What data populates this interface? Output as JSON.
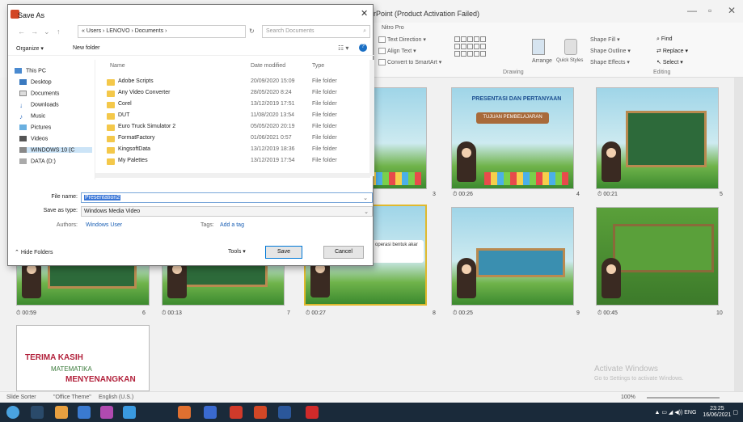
{
  "ppt": {
    "title": "rPoint (Product Activation Failed)",
    "tab_label": "Nitro Pro",
    "ribbon": {
      "text_direction": "Text Direction",
      "align_text": "Align Text",
      "convert_smartart": "Convert to SmartArt",
      "arrange": "Arrange",
      "quick_styles": "Quick Styles",
      "shape_fill": "Shape Fill",
      "shape_outline": "Shape Outline",
      "shape_effects": "Shape Effects",
      "find": "Find",
      "replace": "Replace",
      "select": "Select",
      "group_drawing": "Drawing",
      "group_editing": "Editing"
    }
  },
  "slides": [
    {
      "num": "3",
      "time": ""
    },
    {
      "num": "4",
      "time": "00:26",
      "title": "PRESENTASI DAN PERTANYAAN",
      "box": "TUJUAN PEMBELAJARAN"
    },
    {
      "num": "5",
      "time": "00:21"
    },
    {
      "num": "6",
      "time": "00:59"
    },
    {
      "num": "7",
      "time": "00:13"
    },
    {
      "num": "8",
      "time": "00:27",
      "box": "Hitunglah operasi bentuk akar"
    },
    {
      "num": "9",
      "time": "00:25"
    },
    {
      "num": "10",
      "time": "00:45"
    }
  ],
  "end_slide": {
    "line1": "TERIMA KASIH",
    "line2": "MATEMATIKA",
    "line3": "MENYENANGKAN"
  },
  "watermark": {
    "line1": "Activate Windows",
    "line2": "Go to Settings to activate Windows."
  },
  "status": {
    "view": "Slide Sorter",
    "theme": "\"Office Theme\"",
    "lang": "English (U.S.)",
    "zoom": "100%"
  },
  "tray": {
    "lang": "ENG",
    "time": "23:25",
    "date": "16/06/2021"
  },
  "dialog": {
    "title": "Save As",
    "address": "« Users › LENOVO › Documents ›",
    "search_placeholder": "Search Documents",
    "organize": "Organize ▾",
    "new_folder": "New folder",
    "sidebar": [
      "This PC",
      "Desktop",
      "Documents",
      "Downloads",
      "Music",
      "Pictures",
      "Videos",
      "WINDOWS 10 (C",
      "DATA (D:)"
    ],
    "columns": {
      "name": "Name",
      "date": "Date modified",
      "type": "Type"
    },
    "files": [
      {
        "name": "Adobe Scripts",
        "date": "20/09/2020 15:09",
        "type": "File folder"
      },
      {
        "name": "Any Video Converter",
        "date": "28/05/2020 8:24",
        "type": "File folder"
      },
      {
        "name": "Corel",
        "date": "13/12/2019 17:51",
        "type": "File folder"
      },
      {
        "name": "DUT",
        "date": "11/08/2020 13:54",
        "type": "File folder"
      },
      {
        "name": "Euro Truck Simulator 2",
        "date": "05/05/2020 20:19",
        "type": "File folder"
      },
      {
        "name": "FormatFactory",
        "date": "01/06/2021 0:57",
        "type": "File folder"
      },
      {
        "name": "KingsoftData",
        "date": "13/12/2019 18:36",
        "type": "File folder"
      },
      {
        "name": "My Palettes",
        "date": "13/12/2019 17:54",
        "type": "File folder"
      }
    ],
    "filename_label": "File name:",
    "filename_value": "Presentation2",
    "savetype_label": "Save as type:",
    "savetype_value": "Windows Media Video",
    "authors_label": "Authors:",
    "authors_value": "Windows User",
    "tags_label": "Tags:",
    "tags_value": "Add a tag",
    "hide_folders": "Hide Folders",
    "tools": "Tools",
    "save": "Save",
    "cancel": "Cancel"
  }
}
